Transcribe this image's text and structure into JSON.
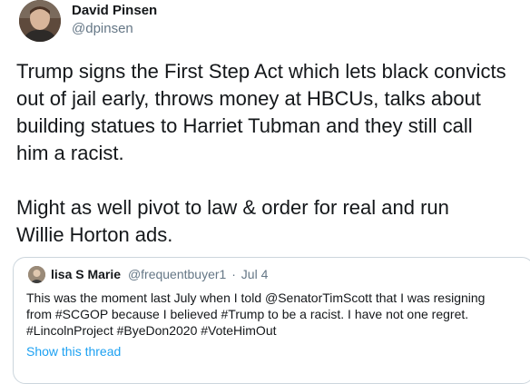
{
  "author": {
    "name": "David Pinsen",
    "handle": "@dpinsen"
  },
  "tweet": {
    "paragraph1_lines": [
      "Trump signs the First Step Act which lets black convicts",
      "out of jail early, throws money at HBCUs, talks about",
      "building statues to Harriet Tubman and they still call",
      "him a racist."
    ],
    "paragraph2_lines": [
      "Might as well pivot to law & order for real and run",
      "Willie Horton ads."
    ]
  },
  "quote": {
    "name": "lisa S Marie",
    "handle": "@frequentbuyer1",
    "separator": "·",
    "date": "Jul 4",
    "lines": [
      "This was the moment last July when I told @SenatorTimScott that I was resigning",
      "from #SCGOP because I believed #Trump to be a racist. I have not one regret.",
      "#LincolnProject #ByeDon2020 #VoteHimOut"
    ],
    "show_thread": "Show this thread"
  },
  "colors": {
    "text": "#14171a",
    "muted": "#657786",
    "link": "#1da1f2",
    "border": "#ccd6dd"
  }
}
